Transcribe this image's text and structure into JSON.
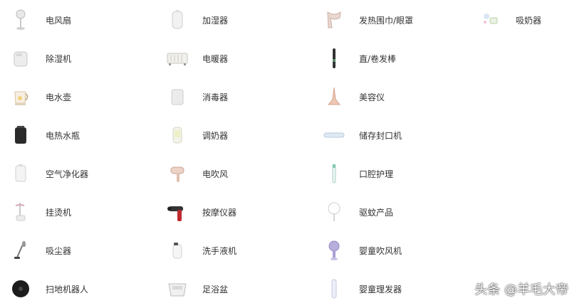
{
  "colors": {
    "text": "#333333",
    "background": "#ffffff"
  },
  "categories": [
    {
      "label": "电风扇",
      "icon": "electric-fan-icon"
    },
    {
      "label": "加湿器",
      "icon": "humidifier-icon"
    },
    {
      "label": "发热围巾/眼罩",
      "icon": "heated-scarf-icon"
    },
    {
      "label": "吸奶器",
      "icon": "breast-pump-icon"
    },
    {
      "label": "除湿机",
      "icon": "dehumidifier-icon"
    },
    {
      "label": "电暖器",
      "icon": "electric-heater-icon"
    },
    {
      "label": "直/卷发棒",
      "icon": "hair-curler-icon"
    },
    {
      "label": "电水壶",
      "icon": "electric-kettle-icon"
    },
    {
      "label": "消毒器",
      "icon": "sterilizer-icon"
    },
    {
      "label": "美容仪",
      "icon": "beauty-device-icon"
    },
    {
      "label": "电热水瓶",
      "icon": "thermo-pot-icon"
    },
    {
      "label": "调奶器",
      "icon": "milk-warmer-icon"
    },
    {
      "label": "储存封口机",
      "icon": "sealing-machine-icon"
    },
    {
      "label": "空气净化器",
      "icon": "air-purifier-icon"
    },
    {
      "label": "电吹风",
      "icon": "hair-dryer-icon"
    },
    {
      "label": "口腔护理",
      "icon": "electric-toothbrush-icon"
    },
    {
      "label": "挂烫机",
      "icon": "garment-steamer-icon"
    },
    {
      "label": "按摩仪器",
      "icon": "massage-gun-icon"
    },
    {
      "label": "驱蚊产品",
      "icon": "mosquito-repellent-icon"
    },
    {
      "label": "吸尘器",
      "icon": "vacuum-cleaner-icon"
    },
    {
      "label": "洗手液机",
      "icon": "soap-dispenser-icon"
    },
    {
      "label": "婴童吹风机",
      "icon": "baby-hair-dryer-icon"
    },
    {
      "label": "扫地机器人",
      "icon": "robot-vacuum-icon"
    },
    {
      "label": "足浴盆",
      "icon": "foot-bath-icon"
    },
    {
      "label": "婴童理发器",
      "icon": "baby-hair-clipper-icon"
    }
  ],
  "watermark": "头条 @羊毛大帝"
}
